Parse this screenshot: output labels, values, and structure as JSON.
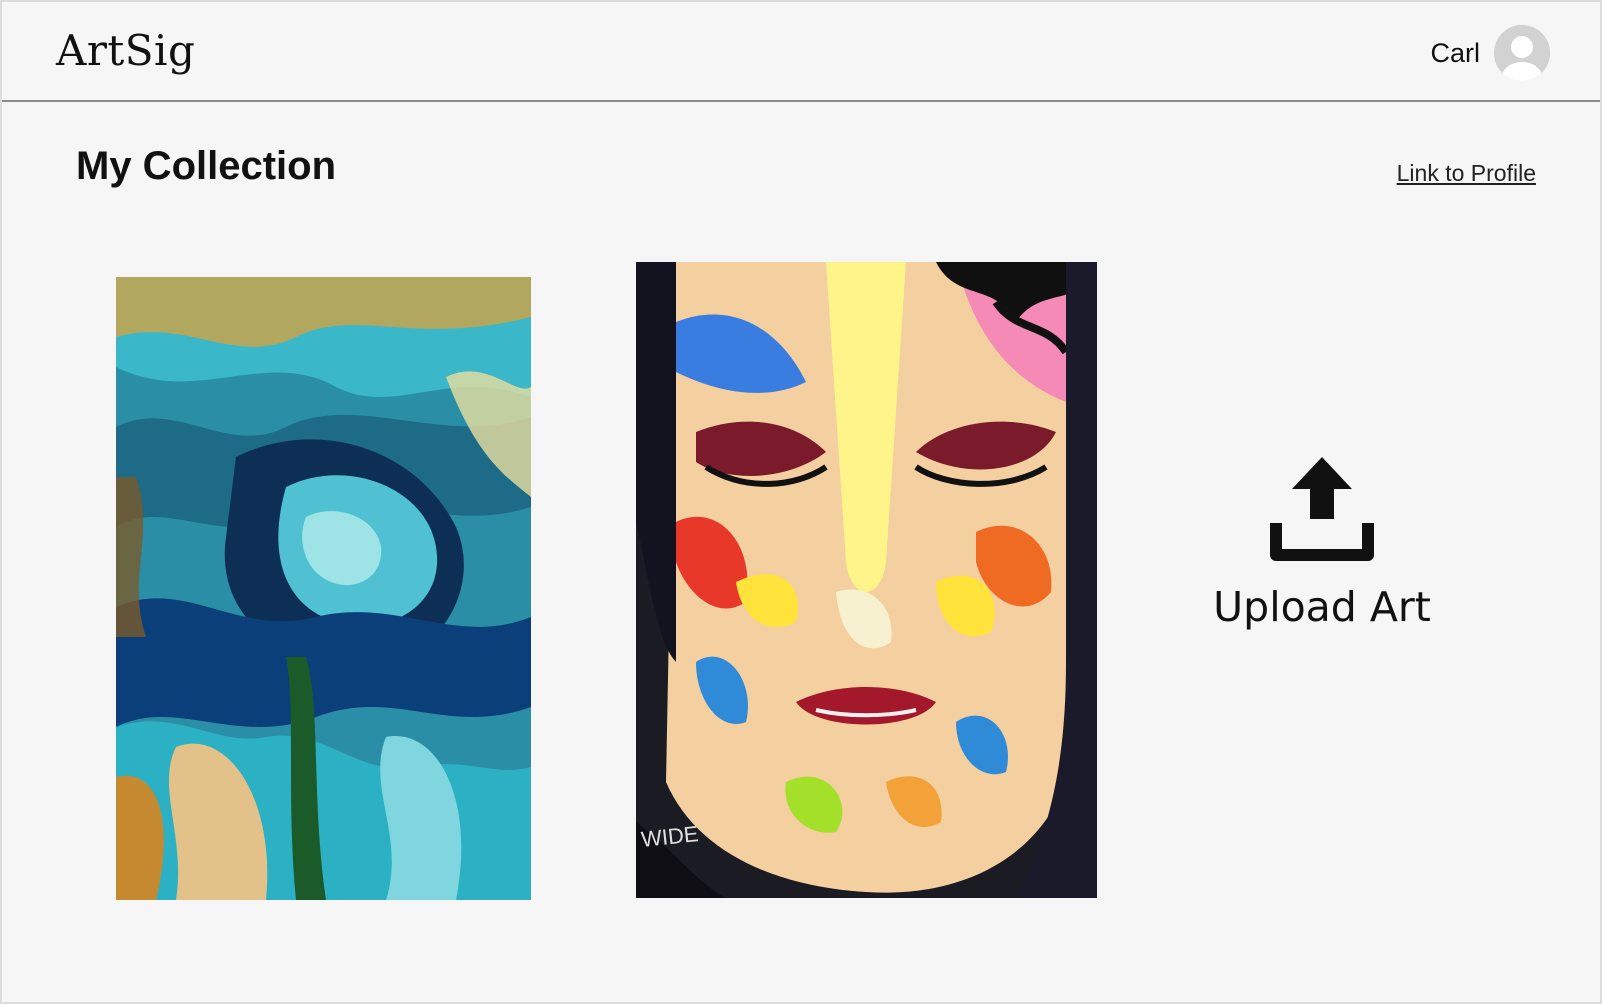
{
  "app": {
    "logo": "ArtSig"
  },
  "user": {
    "name": "Carl",
    "avatar_icon": "user-avatar-icon"
  },
  "main": {
    "title": "My Collection",
    "profile_link": "Link to Profile",
    "artworks": [
      {
        "name": "abstract-swirl-face-painting"
      },
      {
        "name": "colorful-portrait-painting"
      }
    ],
    "upload": {
      "icon": "upload-icon",
      "label": "Upload Art"
    }
  },
  "colors": {
    "background": "#f6f6f6",
    "text": "#111111",
    "divider": "#8a8a8a"
  }
}
